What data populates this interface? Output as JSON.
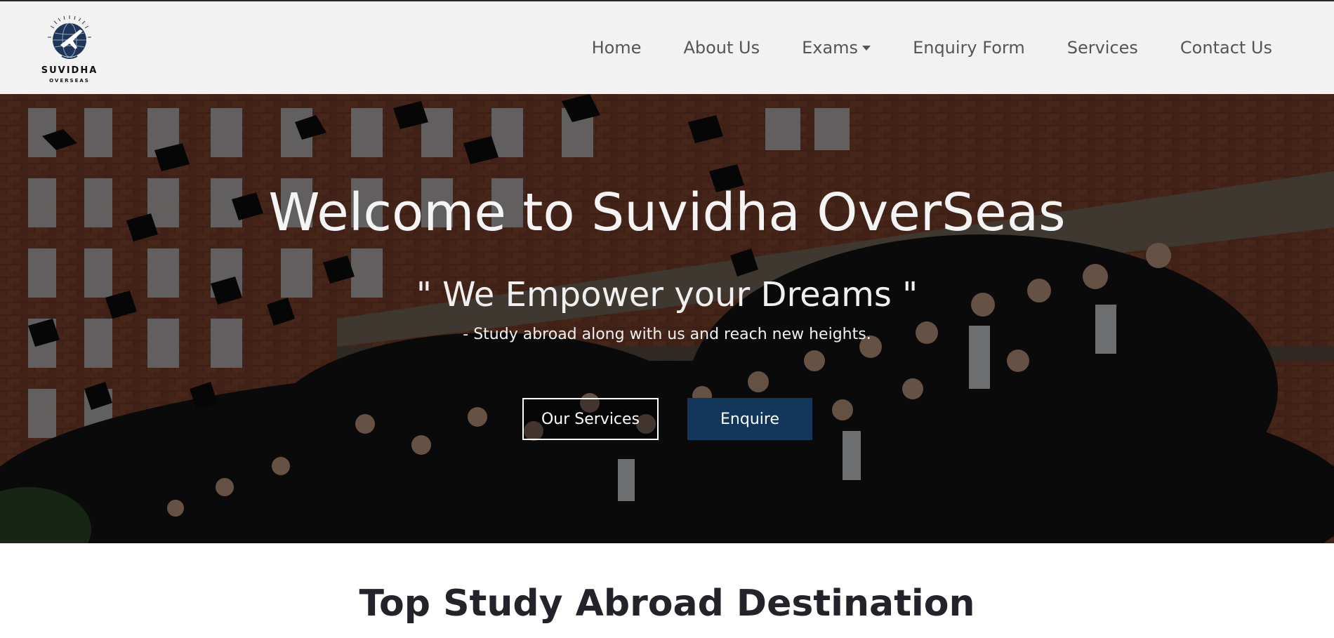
{
  "header": {
    "logo": {
      "brand": "SUVIDHA",
      "sub": "OVERSEAS",
      "icon": "globe-airplane-logo"
    },
    "nav": [
      {
        "label": "Home"
      },
      {
        "label": "About Us"
      },
      {
        "label": "Exams",
        "has_dropdown": true
      },
      {
        "label": "Enquiry Form"
      },
      {
        "label": "Services"
      },
      {
        "label": "Contact Us"
      }
    ]
  },
  "hero": {
    "title": "Welcome to Suvidha OverSeas",
    "tagline": "\" We Empower your Dreams \"",
    "subtitle": "- Study abroad along with us and reach new heights.",
    "buttons": {
      "services": "Our Services",
      "enquire": "Enquire"
    },
    "background": "graduates-throwing-caps-photo"
  },
  "section": {
    "title": "Top Study Abroad Destination"
  },
  "colors": {
    "nav_bg": "#f2f2f2",
    "nav_text": "#555555",
    "enquire_button": "#13375a",
    "section_title": "#23232b"
  }
}
